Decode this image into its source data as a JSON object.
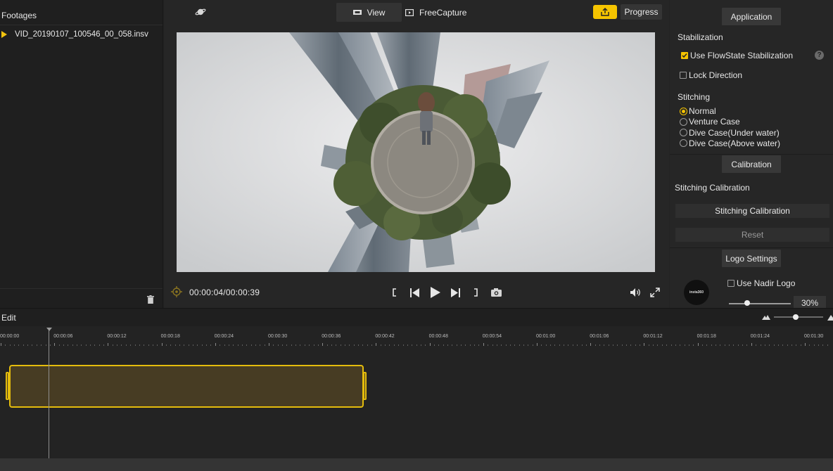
{
  "footages": {
    "title": "Footages",
    "items": [
      {
        "name": "VID_20190107_100546_00_058.insv"
      }
    ]
  },
  "toolbar": {
    "view_tab": "View",
    "freecapture_tab": "FreeCapture",
    "progress_button": "Progress",
    "accent_color": "#f5c400"
  },
  "player": {
    "timecode": "00:00:04/00:00:39"
  },
  "right_panel": {
    "application_button": "Application",
    "stabilization_heading": "Stabilization",
    "flowstate_label": "Use FlowState Stabilization",
    "flowstate_checked": true,
    "lock_direction_label": "Lock Direction",
    "lock_direction_checked": false,
    "stitching_heading": "Stitching",
    "stitching_options": [
      "Normal",
      "Venture Case",
      "Dive Case(Under water)",
      "Dive Case(Above water)"
    ],
    "stitching_selected": "Normal",
    "calibration_button": "Calibration",
    "stitching_calibration_heading": "Stitching Calibration",
    "stitching_calibration_button": "Stitching Calibration",
    "reset_button": "Reset",
    "logo_settings_button": "Logo Settings",
    "nadir_logo_label": "Use Nadir Logo",
    "nadir_logo_checked": false,
    "logo_size_percent": "30%",
    "logo_thumb_text": "insta360"
  },
  "edit": {
    "label": "Edit",
    "ruler_labels": [
      "00:00:00",
      "00:00:06",
      "00:00:12",
      "00:00:18",
      "00:00:24",
      "00:00:30",
      "00:00:36",
      "00:00:42",
      "00:00:48",
      "00:00:54",
      "00:01:00",
      "00:01:06",
      "00:01:12",
      "00:01:18",
      "00:01:24",
      "00:01:30"
    ]
  }
}
